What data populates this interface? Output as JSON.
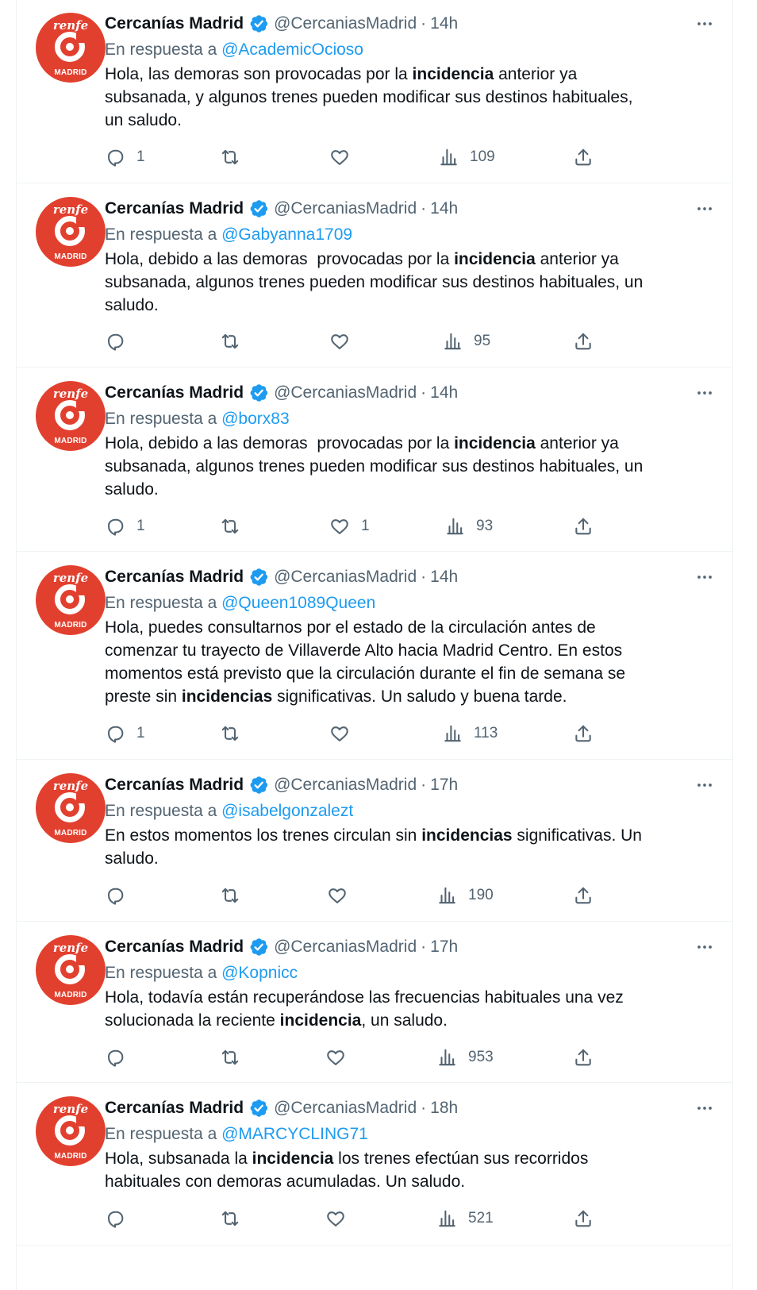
{
  "account": {
    "name": "Cercanías Madrid",
    "handle": "@CercaniasMadrid",
    "avatar_brand": "renfe",
    "avatar_city": "MADRID",
    "verified_icon": "verified-badge-icon",
    "brand_color": "#e2402f",
    "verified_color": "#1d9bf0"
  },
  "reply_prefix": "En respuesta a",
  "separator": "·",
  "tweets": [
    {
      "time": "14h",
      "reply_to": "@AcademicOcioso",
      "text": [
        {
          "t": "Hola, las demoras son provocadas por la "
        },
        {
          "t": "incidencia",
          "b": true
        },
        {
          "t": " anterior ya\nsubsanada, y algunos trenes pueden modificar sus destinos habituales,\nun saludo."
        }
      ],
      "replies": "1",
      "retweets": "",
      "likes": "",
      "views": "109"
    },
    {
      "time": "14h",
      "reply_to": "@Gabyanna1709",
      "text": [
        {
          "t": "Hola, debido a las demoras  provocadas por la "
        },
        {
          "t": "incidencia",
          "b": true
        },
        {
          "t": " anterior ya\nsubsanada, algunos trenes pueden modificar sus destinos habituales, un\nsaludo."
        }
      ],
      "replies": "",
      "retweets": "",
      "likes": "",
      "views": "95"
    },
    {
      "time": "14h",
      "reply_to": "@borx83",
      "text": [
        {
          "t": "Hola, debido a las demoras  provocadas por la "
        },
        {
          "t": "incidencia",
          "b": true
        },
        {
          "t": " anterior ya\nsubsanada, algunos trenes pueden modificar sus destinos habituales, un\nsaludo."
        }
      ],
      "replies": "1",
      "retweets": "",
      "likes": "1",
      "views": "93"
    },
    {
      "time": "14h",
      "reply_to": "@Queen1089Queen",
      "text": [
        {
          "t": "Hola, puedes consultarnos por el estado de la circulación antes de\ncomenzar tu trayecto de Villaverde Alto hacia Madrid Centro. En estos\nmomentos está previsto que la circulación durante el fin de semana se\npreste sin "
        },
        {
          "t": "incidencias",
          "b": true
        },
        {
          "t": " significativas. Un saludo y buena tarde."
        }
      ],
      "replies": "1",
      "retweets": "",
      "likes": "",
      "views": "113"
    },
    {
      "time": "17h",
      "reply_to": "@isabelgonzalezt",
      "text": [
        {
          "t": "En estos momentos los trenes circulan sin "
        },
        {
          "t": "incidencias",
          "b": true
        },
        {
          "t": " significativas. Un\nsaludo."
        }
      ],
      "replies": "",
      "retweets": "",
      "likes": "",
      "views": "190"
    },
    {
      "time": "17h",
      "reply_to": "@Kopnicc",
      "text": [
        {
          "t": "Hola, todavía están recuperándose las frecuencias habituales una vez\nsolucionada la reciente "
        },
        {
          "t": "incidencia",
          "b": true
        },
        {
          "t": ", un saludo."
        }
      ],
      "replies": "",
      "retweets": "",
      "likes": "",
      "views": "953"
    },
    {
      "time": "18h",
      "reply_to": "@MARCYCLING71",
      "text": [
        {
          "t": "Hola, subsanada la "
        },
        {
          "t": "incidencia",
          "b": true
        },
        {
          "t": " los trenes efectúan sus recorridos\nhabituales con demoras acumuladas. Un saludo."
        }
      ],
      "replies": "",
      "retweets": "",
      "likes": "",
      "views": "521"
    }
  ]
}
